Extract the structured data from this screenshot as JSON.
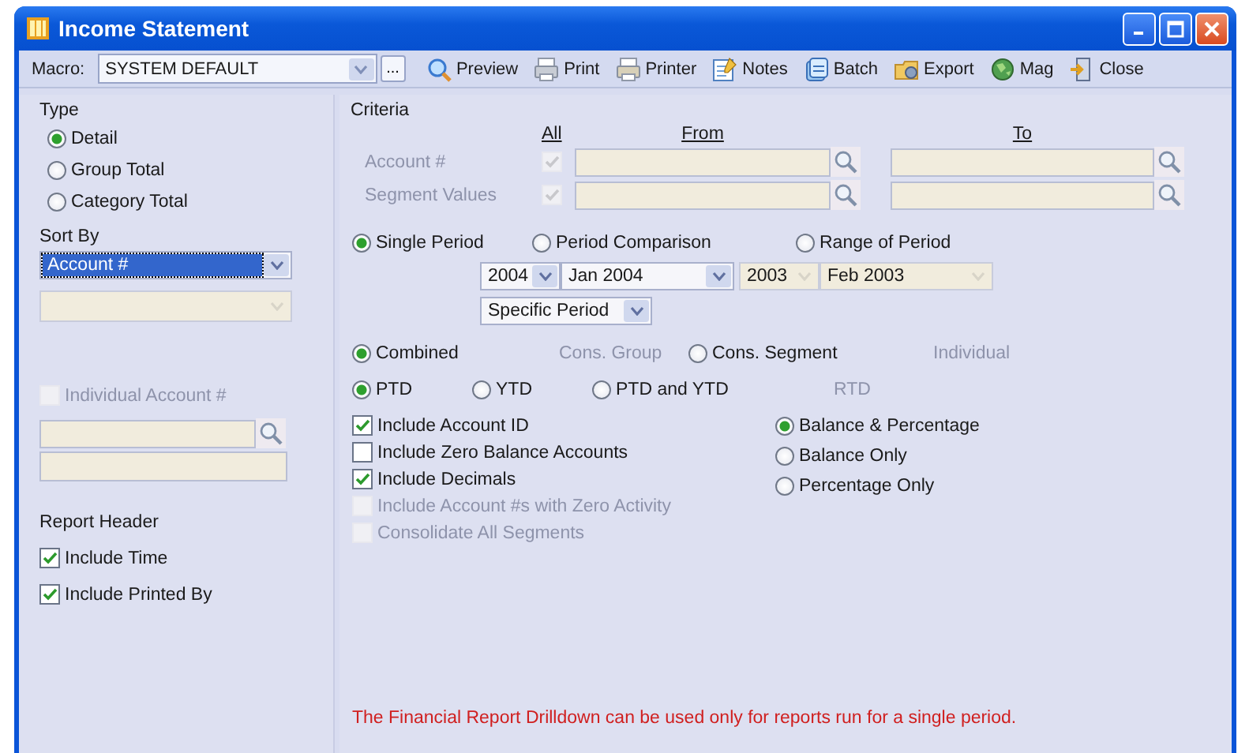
{
  "window": {
    "title": "Income Statement"
  },
  "toolbar": {
    "macro_label": "Macro:",
    "macro_value": "SYSTEM DEFAULT",
    "more_label": "...",
    "buttons": [
      {
        "label": "Preview",
        "kind": "preview"
      },
      {
        "label": "Print",
        "kind": "print"
      },
      {
        "label": "Printer",
        "kind": "printer"
      },
      {
        "label": "Notes",
        "kind": "notes"
      },
      {
        "label": "Batch",
        "kind": "batch"
      },
      {
        "label": "Export",
        "kind": "export"
      },
      {
        "label": "Mag",
        "kind": "mag"
      },
      {
        "label": "Close",
        "kind": "close"
      }
    ]
  },
  "type": {
    "label": "Type",
    "options": [
      {
        "label": "Detail",
        "selected": true
      },
      {
        "label": "Group Total",
        "selected": false
      },
      {
        "label": "Category Total",
        "selected": false
      }
    ]
  },
  "sort_by": {
    "label": "Sort By",
    "fields": [
      {
        "value": "Account #",
        "disabled": false,
        "highlighted": true
      },
      {
        "disabled": true,
        "highlighted": false
      }
    ]
  },
  "individual_account": {
    "label": "Individual Account #",
    "checked": false,
    "disabled": true
  },
  "report_header": {
    "label": "Report Header",
    "options": [
      {
        "label": "Include Time",
        "checked": true
      },
      {
        "label": "Include Printed By",
        "checked": true
      }
    ]
  },
  "criteria": {
    "label": "Criteria",
    "headers": {
      "all": "All",
      "from": "From",
      "to": "To"
    },
    "rows": [
      {
        "label": "Account #",
        "all_checked": true,
        "disabled": true
      },
      {
        "label": "Segment Values",
        "all_checked": true,
        "disabled": true
      }
    ]
  },
  "period": {
    "options": [
      {
        "label": "Single Period",
        "selected": true
      },
      {
        "label": "Period Comparison",
        "selected": false
      },
      {
        "label": "Range of Period",
        "selected": false
      }
    ],
    "selects": [
      {
        "value": "2004",
        "disabled": false
      },
      {
        "value": "Jan 2004",
        "disabled": false
      },
      {
        "value": "2003",
        "disabled": true
      },
      {
        "value": "Feb 2003",
        "disabled": true
      }
    ],
    "mode": {
      "value": "Specific Period",
      "disabled": false
    }
  },
  "consolidation": [
    {
      "label": "Combined",
      "selected": true,
      "disabled": false
    },
    {
      "label": "Cons. Group",
      "selected": false,
      "disabled": true
    },
    {
      "label": "Cons. Segment",
      "selected": false,
      "disabled": false
    },
    {
      "label": "Individual",
      "selected": false,
      "disabled": true
    }
  ],
  "range": [
    {
      "label": "PTD",
      "selected": true,
      "disabled": false
    },
    {
      "label": "YTD",
      "selected": false,
      "disabled": false
    },
    {
      "label": "PTD and YTD",
      "selected": false,
      "disabled": false
    },
    {
      "label": "RTD",
      "selected": false,
      "disabled": true
    }
  ],
  "options": [
    {
      "label": "Include Account ID",
      "checked": true,
      "disabled": false
    },
    {
      "label": "Include Zero Balance Accounts",
      "checked": false,
      "disabled": false
    },
    {
      "label": "Include Decimals",
      "checked": true,
      "disabled": false
    },
    {
      "label": "Include Account #s with Zero Activity",
      "checked": false,
      "disabled": true
    },
    {
      "label": "Consolidate All Segments",
      "checked": false,
      "disabled": true
    }
  ],
  "display": [
    {
      "label": "Balance & Percentage",
      "selected": true
    },
    {
      "label": "Balance Only",
      "selected": false
    },
    {
      "label": "Percentage Only",
      "selected": false
    }
  ],
  "note": "The Financial Report Drilldown can be used only for reports run for a single period."
}
